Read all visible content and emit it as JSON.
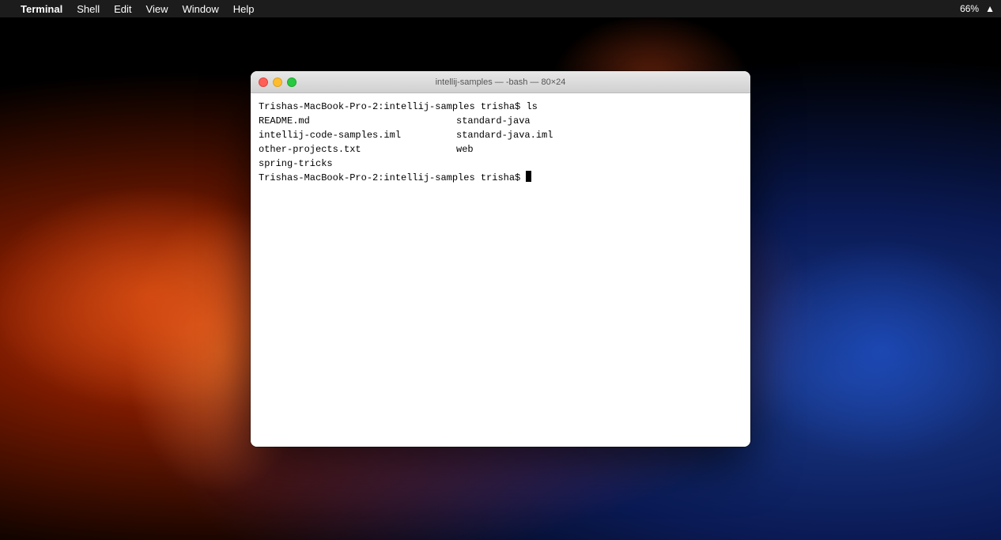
{
  "desktop": {
    "bg_description": "macOS desktop with space nebula wallpaper"
  },
  "menubar": {
    "apple_symbol": "",
    "app_name": "Terminal",
    "items": [
      "Shell",
      "Edit",
      "View",
      "Window",
      "Help"
    ],
    "right": {
      "battery": "66%",
      "wifi": "WiFi",
      "time": ""
    }
  },
  "terminal": {
    "title": "intellij-samples — -bash — 80×24",
    "prompt": "Trishas-MacBook-Pro-2:intellij-samples trisha$",
    "command": "ls",
    "files": [
      {
        "col1": "README.md",
        "col2": "standard-java"
      },
      {
        "col1": "intellij-code-samples.iml",
        "col2": "standard-java.iml"
      },
      {
        "col1": "other-projects.txt",
        "col2": "web"
      },
      {
        "col1": "spring-tricks",
        "col2": ""
      },
      {
        "col1": "",
        "col2": ""
      }
    ],
    "prompt2": "Trishas-MacBook-Pro-2:intellij-samples trisha$"
  }
}
